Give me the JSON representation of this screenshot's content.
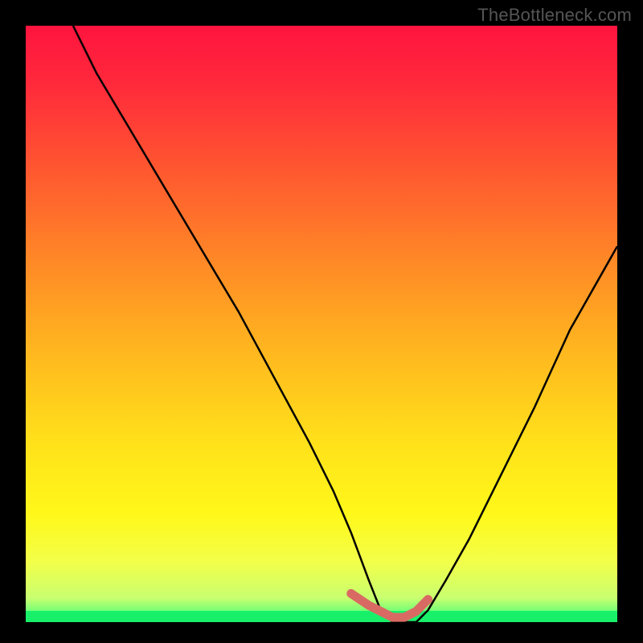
{
  "watermark": "TheBottleneck.com",
  "colors": {
    "frame": "#000000",
    "gradient_stops": [
      {
        "offset": 0.0,
        "color": "#ff143f"
      },
      {
        "offset": 0.1,
        "color": "#ff2a3b"
      },
      {
        "offset": 0.25,
        "color": "#ff5a2f"
      },
      {
        "offset": 0.4,
        "color": "#ff8a26"
      },
      {
        "offset": 0.55,
        "color": "#ffb81f"
      },
      {
        "offset": 0.7,
        "color": "#ffe11a"
      },
      {
        "offset": 0.82,
        "color": "#fff81a"
      },
      {
        "offset": 0.9,
        "color": "#f2ff4a"
      },
      {
        "offset": 0.96,
        "color": "#c8ff70"
      },
      {
        "offset": 1.0,
        "color": "#2bff7a"
      }
    ],
    "curve": "#000000",
    "highlight": "#d96a63",
    "green_strip": "#19f06a"
  },
  "chart_data": {
    "type": "line",
    "title": "",
    "xlabel": "",
    "ylabel": "",
    "xlim": [
      0,
      100
    ],
    "ylim": [
      0,
      100
    ],
    "grid": false,
    "notes": "Bottleneck-style V curve: y-axis runs top(100)→bottom(0). Minimum (0) sits around x≈59–67. Left branch starts near top-left; right branch exits near x=100, y≈63.",
    "series": [
      {
        "name": "bottleneck-curve",
        "x": [
          8,
          12,
          18,
          24,
          30,
          36,
          42,
          48,
          52,
          55,
          58,
          60,
          62,
          64,
          66,
          68,
          71,
          75,
          80,
          86,
          92,
          100
        ],
        "y": [
          100,
          92,
          82,
          72,
          62,
          52,
          41,
          30,
          22,
          15,
          7,
          2,
          0,
          0,
          0,
          2,
          7,
          14,
          24,
          36,
          49,
          63
        ]
      }
    ],
    "highlight_segment": {
      "description": "Thick salmon stroke marking the flat bottom of the V",
      "x": [
        55,
        58,
        60,
        62,
        64,
        66,
        68
      ],
      "y": [
        4,
        2,
        1,
        0,
        0,
        1,
        3
      ]
    }
  }
}
